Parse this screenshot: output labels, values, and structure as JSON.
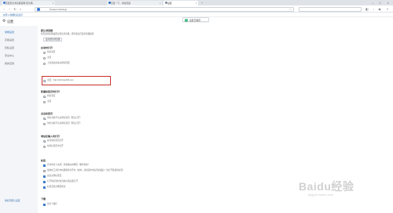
{
  "tabs": [
    {
      "label": "百度安全浏览器官网-安全网...",
      "favicon_color": "#3a7bd5",
      "active": false
    },
    {
      "label": "百度一下，你就知道",
      "favicon_color": "#2d6fc4",
      "active": false
    },
    {
      "label": "设置",
      "favicon_color": "#7a8a99",
      "active": true
    }
  ],
  "address": {
    "url": "browser://settings"
  },
  "bookmarks": {
    "label": "在导入收藏栏后显示"
  },
  "toast": {
    "message": "设置已保存"
  },
  "header": {
    "title": "设置"
  },
  "sidebar": {
    "items": [
      {
        "label": "常规设置",
        "active": true
      },
      {
        "label": "高级设置",
        "active": false
      },
      {
        "label": "隐私设置",
        "active": false
      },
      {
        "label": "安全中心",
        "active": false
      },
      {
        "label": "我的应用",
        "active": false
      }
    ],
    "bottom_link": "恢复到默认设置"
  },
  "sections": {
    "default_browser": {
      "title": "默认浏览器",
      "desc": "将百度浏览器设置为默认浏览器，即可保证百度浏览器最佳",
      "button": "设为默认浏览器"
    },
    "startup": {
      "title": "启动时打开",
      "options": [
        "新标签页",
        "主页",
        "上次退出前未关闭的页面",
        "主页：http://123.hao245.com"
      ],
      "selected_index": 3
    },
    "new_tab": {
      "title": "新建标签页时打开",
      "options": [
        "新标签页",
        "主页"
      ],
      "selected_index": 0
    },
    "tab_click": {
      "title": "点击标签页",
      "options": [
        "单击当前不可关闭标签页（默认打开）",
        "单击当前不可关闭标签页（默认打开）"
      ],
      "selected_index": 0
    },
    "address_input": {
      "title": "地址栏输入时打开",
      "options": [
        "在当前标签页打开",
        "在新标签页中打开"
      ],
      "selected_index": 0
    },
    "tabs_section": {
      "title": "标签",
      "checks": [
        {
          "label": "允许单击下关闭，外观类似的网页（推荐启用）",
          "checked": true
        },
        {
          "label": "使用在工具栏中右键菜单打开时（启用—当前选中的标签的最后一次打开链接的标签）",
          "checked": false
        },
        {
          "label": "双击关闭标签页",
          "checked": true
        },
        {
          "label": "打开新标签时在当前标签后面打开",
          "checked": true
        },
        {
          "label": "标签页显示网页预览",
          "checked": true
        }
      ]
    },
    "download": {
      "title": "下载",
      "checks": [
        {
          "label": "显示下载栏",
          "checked": true
        }
      ]
    }
  },
  "watermark": {
    "brand": "Baidu经验",
    "sub": "jingyan.baidu.com"
  }
}
